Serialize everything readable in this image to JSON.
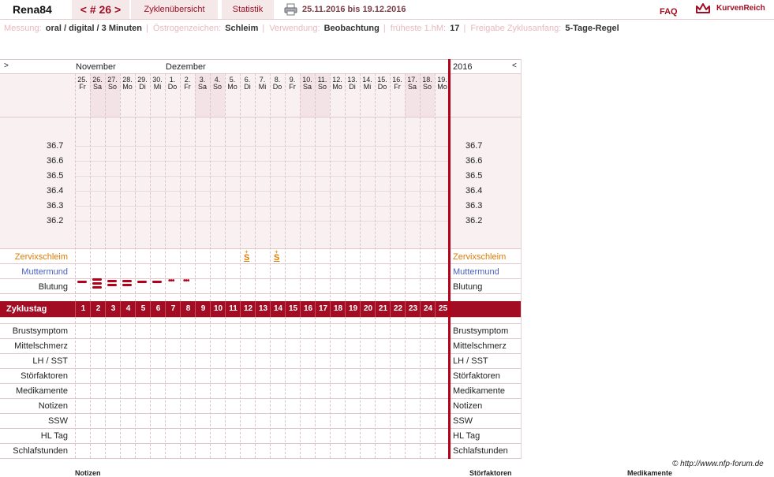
{
  "header": {
    "username": "Rena84",
    "cycle_tab": "< # 26 >",
    "overview_tab": "Zyklenübersicht",
    "stats_tab": "Statistik",
    "date_range": "25.11.2016 bis 19.12.2016",
    "faq": "FAQ",
    "brand": "KurvenReich",
    "print_icon": "printer-icon",
    "brand_icon": "crown-icon"
  },
  "settings": {
    "messung_label": "Messung:",
    "messung_value": "oral / digital / 3 Minuten",
    "oestrogen_label": "Östrogenzeichen:",
    "oestrogen_value": "Schleim",
    "verwendung_label": "Verwendung:",
    "verwendung_value": "Beobachtung",
    "fruehste_label": "früheste 1.hM:",
    "fruehste_value": "17",
    "freigabe_label": "Freigabe Zyklusanfang:",
    "freigabe_value": "5-Tage-Regel"
  },
  "chart": {
    "nav_prev": ">",
    "nav_next": "<",
    "year": "2016",
    "month_1": "November",
    "month_2": "Dezember",
    "days": [
      {
        "d": "25.",
        "w": "Fr",
        "we": false
      },
      {
        "d": "26.",
        "w": "Sa",
        "we": true
      },
      {
        "d": "27.",
        "w": "So",
        "we": true
      },
      {
        "d": "28.",
        "w": "Mo",
        "we": false
      },
      {
        "d": "29.",
        "w": "Di",
        "we": false
      },
      {
        "d": "30.",
        "w": "Mi",
        "we": false
      },
      {
        "d": "1.",
        "w": "Do",
        "we": false
      },
      {
        "d": "2.",
        "w": "Fr",
        "we": false
      },
      {
        "d": "3.",
        "w": "Sa",
        "we": true
      },
      {
        "d": "4.",
        "w": "So",
        "we": true
      },
      {
        "d": "5.",
        "w": "Mo",
        "we": false
      },
      {
        "d": "6.",
        "w": "Di",
        "we": false
      },
      {
        "d": "7.",
        "w": "Mi",
        "we": false
      },
      {
        "d": "8.",
        "w": "Do",
        "we": false
      },
      {
        "d": "9.",
        "w": "Fr",
        "we": false
      },
      {
        "d": "10.",
        "w": "Sa",
        "we": true
      },
      {
        "d": "11.",
        "w": "So",
        "we": true
      },
      {
        "d": "12.",
        "w": "Mo",
        "we": false
      },
      {
        "d": "13.",
        "w": "Di",
        "we": false
      },
      {
        "d": "14.",
        "w": "Mi",
        "we": false
      },
      {
        "d": "15.",
        "w": "Do",
        "we": false
      },
      {
        "d": "16.",
        "w": "Fr",
        "we": false
      },
      {
        "d": "17.",
        "w": "Sa",
        "we": true
      },
      {
        "d": "18.",
        "w": "So",
        "we": true
      },
      {
        "d": "19.",
        "w": "Mo",
        "we": false
      }
    ],
    "temps": [
      "36.7",
      "36.6",
      "36.5",
      "36.4",
      "36.3",
      "36.2"
    ],
    "rows_top": {
      "zervix": "Zervixschleim",
      "muttermund": "Muttermund",
      "blutung": "Blutung"
    },
    "mucus_symbol": "S",
    "mucus_mark": "+",
    "mucus_days": [
      12,
      14
    ],
    "bleeding": [
      {
        "day": 1,
        "strength": "light"
      },
      {
        "day": 2,
        "strength": "heavy"
      },
      {
        "day": 3,
        "strength": "medium"
      },
      {
        "day": 4,
        "strength": "medium"
      },
      {
        "day": 5,
        "strength": "light"
      },
      {
        "day": 6,
        "strength": "light"
      },
      {
        "day": 7,
        "strength": "spotting"
      },
      {
        "day": 8,
        "strength": "spotting"
      }
    ],
    "cycleday_label": "Zyklustag",
    "cycledays": [
      "1",
      "2",
      "3",
      "4",
      "5",
      "6",
      "7",
      "8",
      "9",
      "10",
      "11",
      "12",
      "13",
      "14",
      "15",
      "16",
      "17",
      "18",
      "19",
      "20",
      "21",
      "22",
      "23",
      "24",
      "25"
    ],
    "rows_bottom": [
      "Brustsymptom",
      "Mittelschmerz",
      "LH / SST",
      "Störfaktoren",
      "Medikamente",
      "Notizen",
      "SSW",
      "HL Tag",
      "Schlafstunden"
    ]
  },
  "footer": {
    "copyright": "© http://www.nfp-forum.de",
    "notizen": "Notizen",
    "stoerfaktoren": "Störfaktoren",
    "medikamente": "Medikamente"
  },
  "colors": {
    "accent": "#a30d24",
    "tab_bg": "#f4e8e9",
    "weekend": "#f3e3e6",
    "mucus": "#e07b00",
    "muttermund": "#4a5fc1"
  }
}
